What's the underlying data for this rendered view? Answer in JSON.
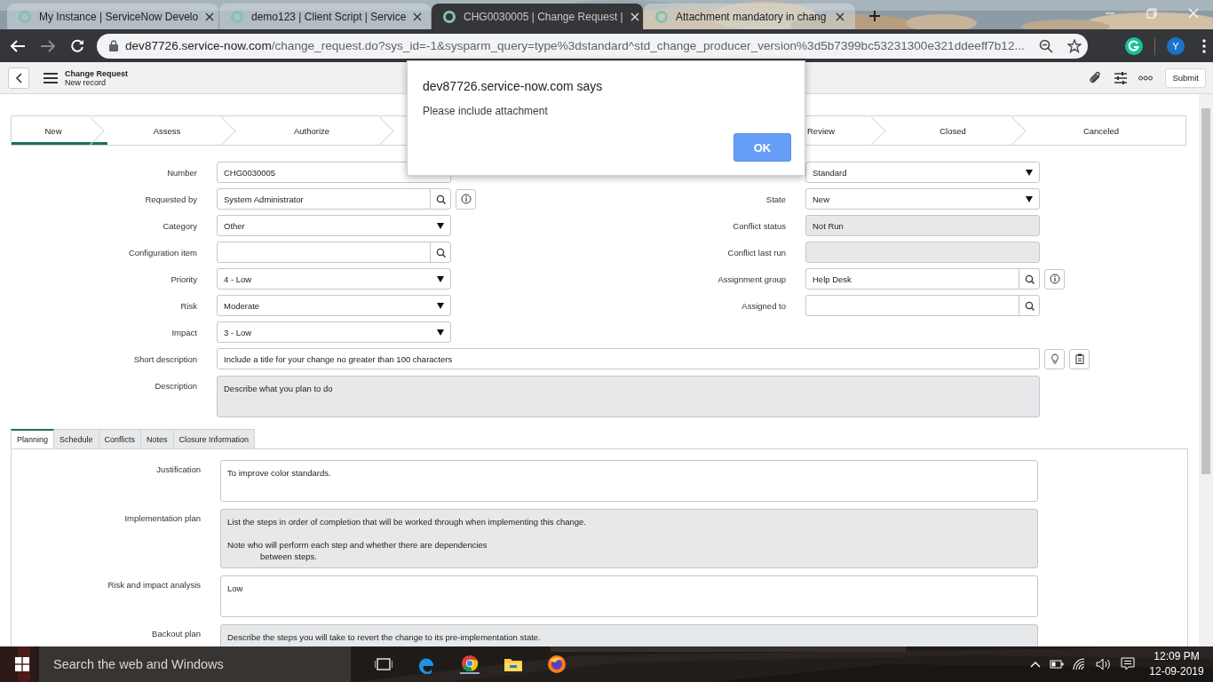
{
  "browser": {
    "tabs": [
      {
        "title": "My Instance | ServiceNow Develo",
        "selected": false
      },
      {
        "title": "demo123 | Client Script | Service",
        "selected": false
      },
      {
        "title": "CHG0030005 | Change Request |",
        "selected": true
      },
      {
        "title": "Attachment mandatory in chang",
        "selected": false
      }
    ],
    "url_host": "dev87726.service-now.com",
    "url_path": "/change_request.do?sys_id=-1&sysparm_query=type%3dstandard^std_change_producer_version%3d5b7399bc53231300e321ddeeff7b12...",
    "profile_initial": "Y"
  },
  "header": {
    "title": "Change Request",
    "subtitle": "New record",
    "submit_label": "Submit"
  },
  "dialog": {
    "title": "dev87726.service-now.com says",
    "message": "Please include attachment",
    "button": "OK"
  },
  "process_flow": [
    {
      "label": "New",
      "selected": true
    },
    {
      "label": "Assess",
      "selected": false
    },
    {
      "label": "Authorize",
      "selected": false
    },
    {
      "label": "Review",
      "selected": false
    },
    {
      "label": "Closed",
      "selected": false
    },
    {
      "label": "Canceled",
      "selected": false
    }
  ],
  "fields_left": [
    {
      "label": "Number",
      "kind": "text",
      "value": "CHG0030005",
      "info": false
    },
    {
      "label": "Requested by",
      "kind": "lookup",
      "value": "System Administrator",
      "info": true
    },
    {
      "label": "Category",
      "kind": "select",
      "value": "Other",
      "info": false
    },
    {
      "label": "Configuration item",
      "kind": "lookup",
      "info": false
    },
    {
      "label": "Priority",
      "kind": "select",
      "value": "4 - Low",
      "info": false
    },
    {
      "label": "Risk",
      "kind": "select",
      "value": "Moderate",
      "info": false
    },
    {
      "label": "Impact",
      "kind": "select",
      "value": "3 - Low",
      "info": false
    }
  ],
  "fields_right": [
    {
      "kind": "select",
      "value": "Standard",
      "info": false
    },
    {
      "label": "State",
      "kind": "select",
      "value": "New",
      "info": false
    },
    {
      "label": "Conflict status",
      "kind": "readonly",
      "value": "Not Run",
      "info": false
    },
    {
      "label": "Conflict last run",
      "kind": "readonly",
      "info": false
    },
    {
      "label": "Assignment group",
      "kind": "lookup",
      "value": "Help Desk",
      "info": true
    },
    {
      "label": "Assigned to",
      "kind": "lookup",
      "info": false
    }
  ],
  "fields_wide": [
    {
      "label": "Short description",
      "kind": "text",
      "value": "Include a title for your change no greater than 100 characters",
      "tools": true
    },
    {
      "label": "Description",
      "kind": "textarea_readonly",
      "value": "Describe what you plan to do",
      "tools": false
    }
  ],
  "form_tabs": [
    {
      "label": "Planning",
      "selected": true
    },
    {
      "label": "Schedule",
      "selected": false
    },
    {
      "label": "Conflicts",
      "selected": false
    },
    {
      "label": "Notes",
      "selected": false
    },
    {
      "label": "Closure Information",
      "selected": false
    }
  ],
  "planning_fields": [
    {
      "label": "Justification",
      "kind": "textarea",
      "value": "To improve color standards."
    },
    {
      "label": "Implementation plan",
      "kind": "textarea_readonly",
      "value": "List the steps in order of completion that will be worked through when implementing this change.\n\nNote who will perform each step and whether there are dependencies\n              between steps."
    },
    {
      "label": "Risk and impact analysis",
      "kind": "textarea",
      "value": "Low"
    },
    {
      "label": "Backout plan",
      "kind": "textarea_readonly",
      "value": "Describe the steps you will take to revert the change to its pre-implementation state."
    }
  ],
  "taskbar": {
    "search_placeholder": "Search the web and Windows",
    "time": "12:09 PM",
    "date": "12-09-2019"
  }
}
